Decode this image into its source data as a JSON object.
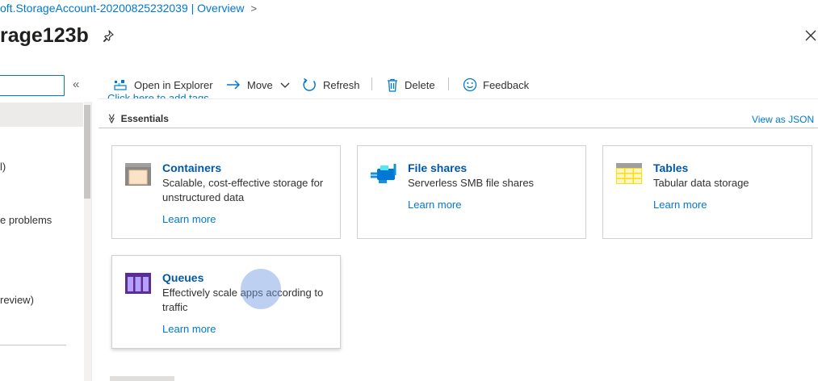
{
  "header": {
    "breadcrumb": "oft.StorageAccount-20200825232039 | Overview",
    "breadcrumb_chevron": ">",
    "title": "rage123b"
  },
  "icons": {
    "pin": "pin-icon",
    "close": "close-icon",
    "collapse": "double-chevron-left-icon"
  },
  "sidebar": {
    "collapse_label": "«",
    "search_value": "",
    "items": [
      {
        "label": "l)"
      },
      {
        "label": "e problems"
      },
      {
        "label": "review)"
      }
    ]
  },
  "toolbar": {
    "open_explorer": "Open in Explorer",
    "move": "Move",
    "refresh": "Refresh",
    "delete": "Delete",
    "feedback": "Feedback"
  },
  "tags_link": "Click here to add tags",
  "essentials": {
    "label": "Essentials",
    "toggle": "≫",
    "view_json": "View as JSON"
  },
  "cards": [
    {
      "title": "Containers",
      "desc": "Scalable, cost-effective storage for unstructured data",
      "link": "Learn more",
      "icon": "containers-icon"
    },
    {
      "title": "File shares",
      "desc": "Serverless SMB file shares",
      "link": "Learn more",
      "icon": "file-shares-icon"
    },
    {
      "title": "Tables",
      "desc": "Tabular data storage",
      "link": "Learn more",
      "icon": "tables-icon"
    },
    {
      "title": "Queues",
      "desc": "Effectively scale apps according to traffic",
      "link": "Learn more",
      "icon": "queues-icon"
    }
  ],
  "colors": {
    "accent": "#0078d4",
    "card_title": "#0058ad"
  }
}
